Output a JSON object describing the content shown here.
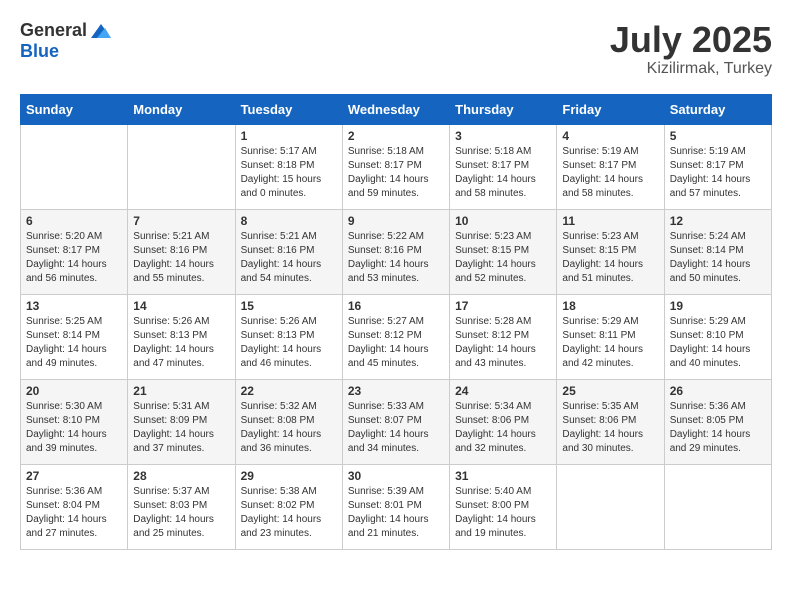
{
  "logo": {
    "general": "General",
    "blue": "Blue"
  },
  "title": {
    "month": "July 2025",
    "location": "Kizilirmak, Turkey"
  },
  "weekdays": [
    "Sunday",
    "Monday",
    "Tuesday",
    "Wednesday",
    "Thursday",
    "Friday",
    "Saturday"
  ],
  "weeks": [
    [
      {
        "day": "",
        "content": ""
      },
      {
        "day": "",
        "content": ""
      },
      {
        "day": "1",
        "content": "Sunrise: 5:17 AM\nSunset: 8:18 PM\nDaylight: 15 hours\nand 0 minutes."
      },
      {
        "day": "2",
        "content": "Sunrise: 5:18 AM\nSunset: 8:17 PM\nDaylight: 14 hours\nand 59 minutes."
      },
      {
        "day": "3",
        "content": "Sunrise: 5:18 AM\nSunset: 8:17 PM\nDaylight: 14 hours\nand 58 minutes."
      },
      {
        "day": "4",
        "content": "Sunrise: 5:19 AM\nSunset: 8:17 PM\nDaylight: 14 hours\nand 58 minutes."
      },
      {
        "day": "5",
        "content": "Sunrise: 5:19 AM\nSunset: 8:17 PM\nDaylight: 14 hours\nand 57 minutes."
      }
    ],
    [
      {
        "day": "6",
        "content": "Sunrise: 5:20 AM\nSunset: 8:17 PM\nDaylight: 14 hours\nand 56 minutes."
      },
      {
        "day": "7",
        "content": "Sunrise: 5:21 AM\nSunset: 8:16 PM\nDaylight: 14 hours\nand 55 minutes."
      },
      {
        "day": "8",
        "content": "Sunrise: 5:21 AM\nSunset: 8:16 PM\nDaylight: 14 hours\nand 54 minutes."
      },
      {
        "day": "9",
        "content": "Sunrise: 5:22 AM\nSunset: 8:16 PM\nDaylight: 14 hours\nand 53 minutes."
      },
      {
        "day": "10",
        "content": "Sunrise: 5:23 AM\nSunset: 8:15 PM\nDaylight: 14 hours\nand 52 minutes."
      },
      {
        "day": "11",
        "content": "Sunrise: 5:23 AM\nSunset: 8:15 PM\nDaylight: 14 hours\nand 51 minutes."
      },
      {
        "day": "12",
        "content": "Sunrise: 5:24 AM\nSunset: 8:14 PM\nDaylight: 14 hours\nand 50 minutes."
      }
    ],
    [
      {
        "day": "13",
        "content": "Sunrise: 5:25 AM\nSunset: 8:14 PM\nDaylight: 14 hours\nand 49 minutes."
      },
      {
        "day": "14",
        "content": "Sunrise: 5:26 AM\nSunset: 8:13 PM\nDaylight: 14 hours\nand 47 minutes."
      },
      {
        "day": "15",
        "content": "Sunrise: 5:26 AM\nSunset: 8:13 PM\nDaylight: 14 hours\nand 46 minutes."
      },
      {
        "day": "16",
        "content": "Sunrise: 5:27 AM\nSunset: 8:12 PM\nDaylight: 14 hours\nand 45 minutes."
      },
      {
        "day": "17",
        "content": "Sunrise: 5:28 AM\nSunset: 8:12 PM\nDaylight: 14 hours\nand 43 minutes."
      },
      {
        "day": "18",
        "content": "Sunrise: 5:29 AM\nSunset: 8:11 PM\nDaylight: 14 hours\nand 42 minutes."
      },
      {
        "day": "19",
        "content": "Sunrise: 5:29 AM\nSunset: 8:10 PM\nDaylight: 14 hours\nand 40 minutes."
      }
    ],
    [
      {
        "day": "20",
        "content": "Sunrise: 5:30 AM\nSunset: 8:10 PM\nDaylight: 14 hours\nand 39 minutes."
      },
      {
        "day": "21",
        "content": "Sunrise: 5:31 AM\nSunset: 8:09 PM\nDaylight: 14 hours\nand 37 minutes."
      },
      {
        "day": "22",
        "content": "Sunrise: 5:32 AM\nSunset: 8:08 PM\nDaylight: 14 hours\nand 36 minutes."
      },
      {
        "day": "23",
        "content": "Sunrise: 5:33 AM\nSunset: 8:07 PM\nDaylight: 14 hours\nand 34 minutes."
      },
      {
        "day": "24",
        "content": "Sunrise: 5:34 AM\nSunset: 8:06 PM\nDaylight: 14 hours\nand 32 minutes."
      },
      {
        "day": "25",
        "content": "Sunrise: 5:35 AM\nSunset: 8:06 PM\nDaylight: 14 hours\nand 30 minutes."
      },
      {
        "day": "26",
        "content": "Sunrise: 5:36 AM\nSunset: 8:05 PM\nDaylight: 14 hours\nand 29 minutes."
      }
    ],
    [
      {
        "day": "27",
        "content": "Sunrise: 5:36 AM\nSunset: 8:04 PM\nDaylight: 14 hours\nand 27 minutes."
      },
      {
        "day": "28",
        "content": "Sunrise: 5:37 AM\nSunset: 8:03 PM\nDaylight: 14 hours\nand 25 minutes."
      },
      {
        "day": "29",
        "content": "Sunrise: 5:38 AM\nSunset: 8:02 PM\nDaylight: 14 hours\nand 23 minutes."
      },
      {
        "day": "30",
        "content": "Sunrise: 5:39 AM\nSunset: 8:01 PM\nDaylight: 14 hours\nand 21 minutes."
      },
      {
        "day": "31",
        "content": "Sunrise: 5:40 AM\nSunset: 8:00 PM\nDaylight: 14 hours\nand 19 minutes."
      },
      {
        "day": "",
        "content": ""
      },
      {
        "day": "",
        "content": ""
      }
    ]
  ]
}
